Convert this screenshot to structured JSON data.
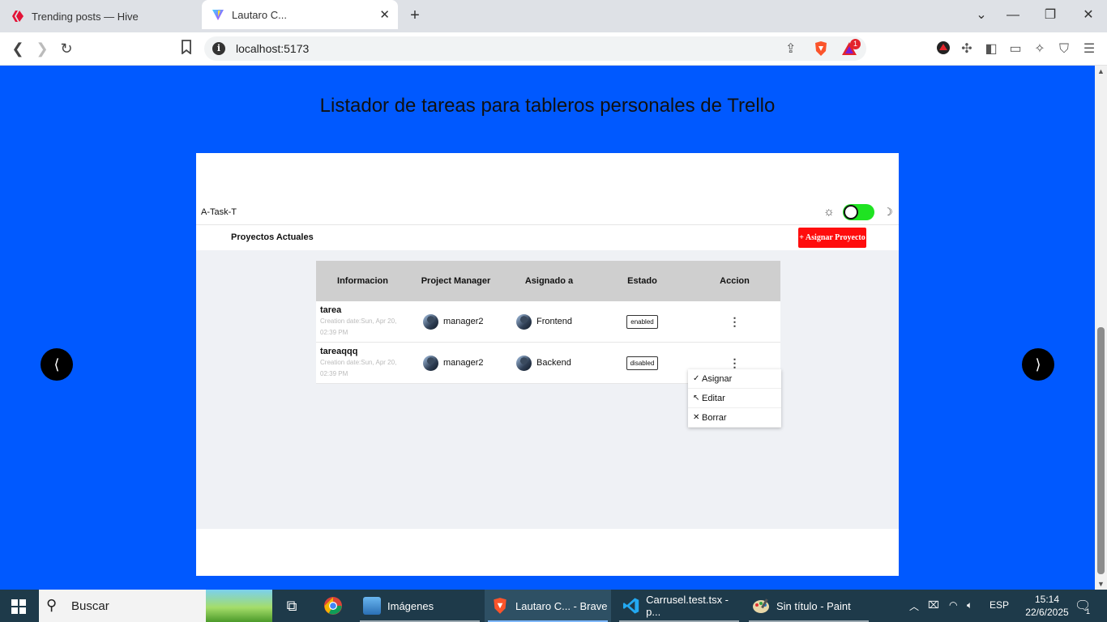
{
  "browser": {
    "tabs": [
      {
        "title": "Trending posts — Hive",
        "active": false
      },
      {
        "title": "Lautaro C...",
        "active": true
      }
    ],
    "url": "localhost:5173",
    "rewards_count": "1",
    "brand_color": "#fb542b"
  },
  "page": {
    "title": "Listador de tareas para tableros personales de Trello",
    "background": "#0059ff"
  },
  "carousel": {
    "prev_label": "⟨",
    "next_label": "⟩"
  },
  "app": {
    "name": "A-Task-T",
    "theme_toggle_on": true,
    "section_title": "Proyectos Actuales",
    "assign_button": "+ Asignar Proyecto",
    "accent_color": "#ff0d0d",
    "toggle_color": "#1fe322"
  },
  "table": {
    "headers": [
      "Informacion",
      "Project Manager",
      "Asignado a",
      "Estado",
      "Accion"
    ],
    "rows": [
      {
        "name": "tarea",
        "date_line1": "Creation date:Sun, Apr 20,",
        "date_line2": "02:39 PM",
        "manager": "manager2",
        "assigned": "Frontend",
        "status": "enabled",
        "action": "⋮"
      },
      {
        "name": "tareaqqq",
        "date_line1": "Creation date:Sun, Apr 20,",
        "date_line2": "02:39 PM",
        "manager": "manager2",
        "assigned": "Backend",
        "status": "disabled",
        "action": "⋮"
      }
    ]
  },
  "context_menu": {
    "items": [
      {
        "icon": "✓",
        "label": "Asignar"
      },
      {
        "icon": "↖",
        "label": "Editar"
      },
      {
        "icon": "✕",
        "label": "Borrar"
      }
    ]
  },
  "taskbar": {
    "search_placeholder": "Buscar",
    "apps": [
      {
        "label": "Imágenes"
      },
      {
        "label": "Lautaro C... - Brave"
      },
      {
        "label": "Carrusel.test.tsx - p..."
      },
      {
        "label": "Sin título - Paint"
      }
    ],
    "language": "ESP",
    "time": "15:14",
    "date": "22/6/2025",
    "notifications": "1"
  }
}
